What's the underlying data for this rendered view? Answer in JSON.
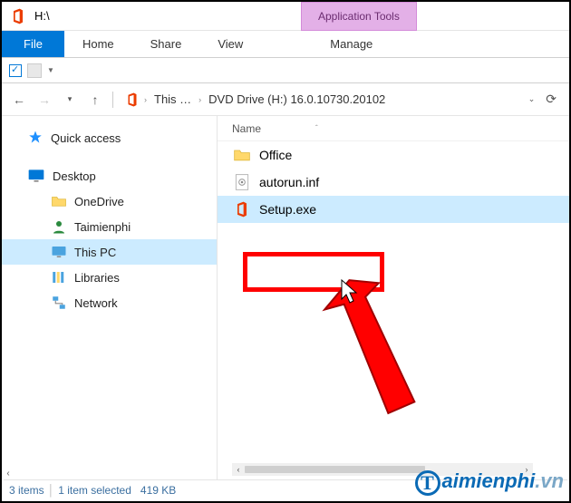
{
  "titlebar": {
    "title": "H:\\",
    "tool_tab": "Application Tools"
  },
  "ribbon": {
    "file": "File",
    "home": "Home",
    "share": "Share",
    "view": "View",
    "manage": "Manage"
  },
  "breadcrumb": {
    "root": "This …",
    "drive": "DVD Drive (H:) 16.0.10730.20102"
  },
  "list": {
    "header_name": "Name",
    "items": [
      {
        "label": "Office",
        "kind": "folder"
      },
      {
        "label": "autorun.inf",
        "kind": "inf"
      },
      {
        "label": "Setup.exe",
        "kind": "exe",
        "selected": true
      }
    ]
  },
  "tree": {
    "quick_access": "Quick access",
    "desktop": "Desktop",
    "onedrive": "OneDrive",
    "user": "Taimienphi",
    "this_pc": "This PC",
    "libraries": "Libraries",
    "network": "Network"
  },
  "status": {
    "count": "3 items",
    "selection": "1 item selected",
    "size": "419 KB"
  },
  "watermark": {
    "t1": "aimienphi",
    "t2": ".vn",
    "badge": "T"
  }
}
